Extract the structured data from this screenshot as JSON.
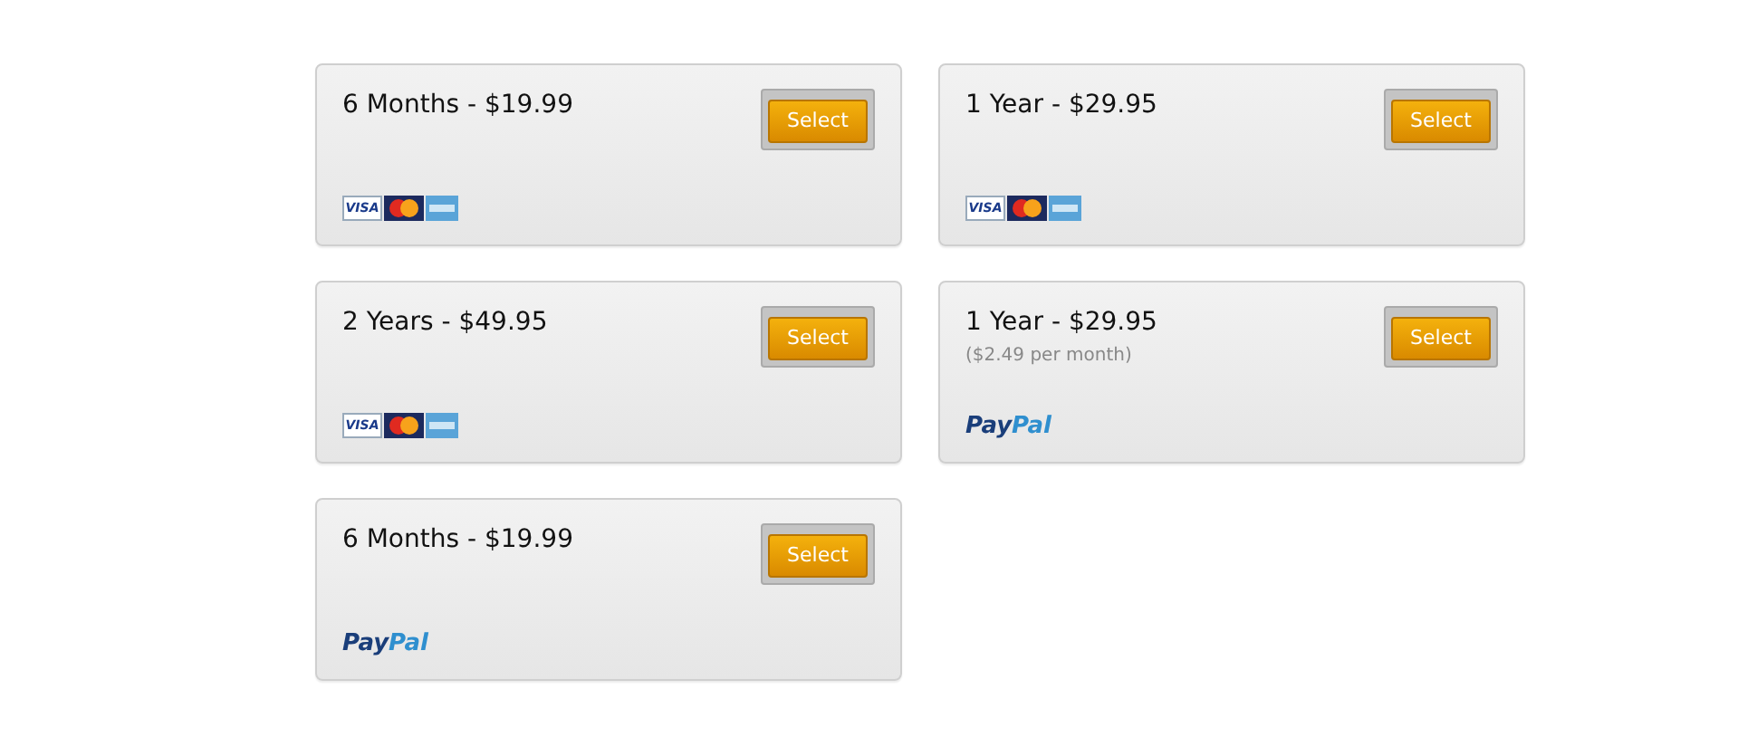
{
  "plans": [
    {
      "title": "6 Months - $19.99",
      "button": "Select",
      "payment": {
        "kind": "cards",
        "visa": "VISA"
      }
    },
    {
      "title": "1 Year - $29.95",
      "button": "Select",
      "payment": {
        "kind": "cards",
        "visa": "VISA"
      }
    },
    {
      "title": "2 Years - $49.95",
      "button": "Select",
      "payment": {
        "kind": "cards",
        "visa": "VISA"
      }
    },
    {
      "title": "1 Year - $29.95",
      "note": "($2.49 per month)",
      "button": "Select",
      "payment": {
        "kind": "paypal",
        "pay": "Pay",
        "pal": "Pal"
      }
    },
    {
      "title": "6 Months - $19.99",
      "button": "Select",
      "payment": {
        "kind": "paypal",
        "pay": "Pay",
        "pal": "Pal"
      }
    }
  ]
}
